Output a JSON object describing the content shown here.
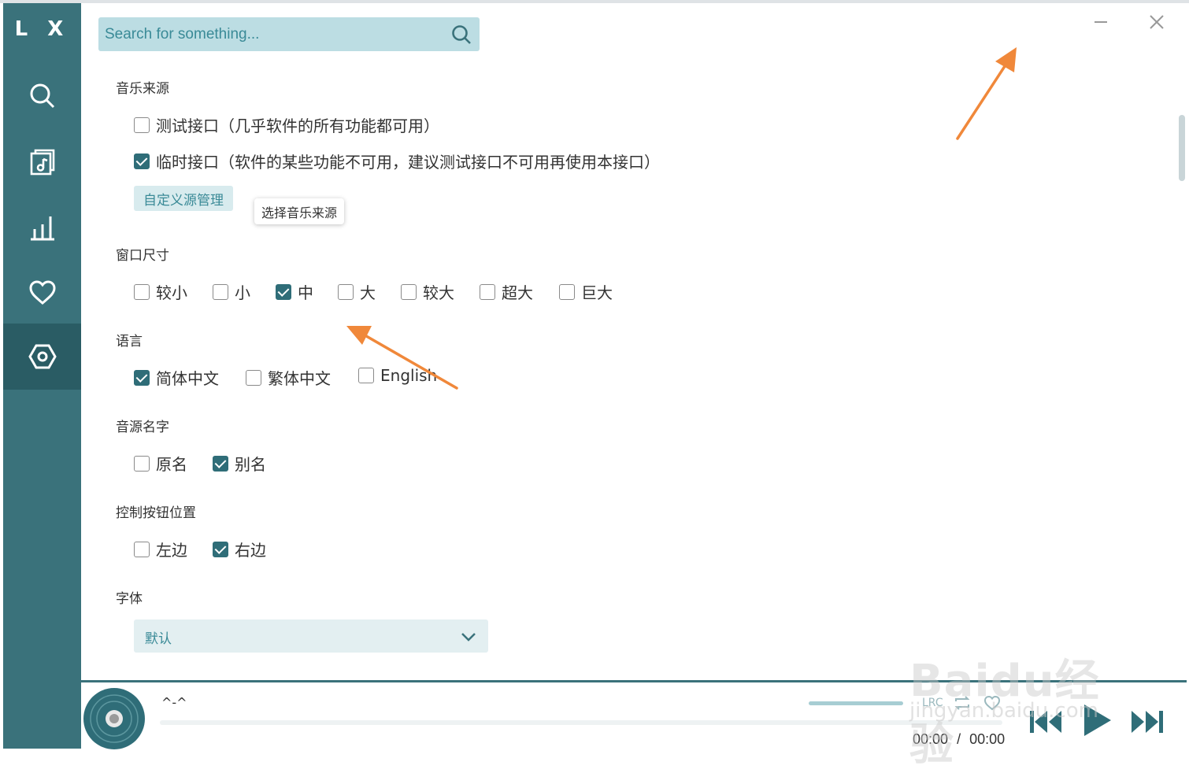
{
  "app": {
    "logo": "L X"
  },
  "sidebar": {
    "items": [
      {
        "name": "search"
      },
      {
        "name": "song-list"
      },
      {
        "name": "leaderboard"
      },
      {
        "name": "favorites"
      },
      {
        "name": "settings",
        "active": true
      }
    ]
  },
  "search": {
    "placeholder": "Search for something..."
  },
  "settings": {
    "music_source": {
      "title": "音乐来源",
      "options": [
        {
          "label": "测试接口（几乎软件的所有功能都可用）",
          "checked": false
        },
        {
          "label": "临时接口（软件的某些功能不可用，建议测试接口不可用再使用本接口）",
          "checked": true
        }
      ],
      "custom_button": "自定义源管理",
      "tooltip": "选择音乐来源"
    },
    "window_size": {
      "title": "窗口尺寸",
      "options": [
        {
          "label": "较小",
          "checked": false
        },
        {
          "label": "小",
          "checked": false
        },
        {
          "label": "中",
          "checked": true
        },
        {
          "label": "大",
          "checked": false
        },
        {
          "label": "较大",
          "checked": false
        },
        {
          "label": "超大",
          "checked": false
        },
        {
          "label": "巨大",
          "checked": false
        }
      ]
    },
    "language": {
      "title": "语言",
      "options": [
        {
          "label": "简体中文",
          "checked": true
        },
        {
          "label": "繁体中文",
          "checked": false
        },
        {
          "label": "English",
          "checked": false
        }
      ]
    },
    "source_name": {
      "title": "音源名字",
      "options": [
        {
          "label": "原名",
          "checked": false
        },
        {
          "label": "别名",
          "checked": true
        }
      ]
    },
    "control_position": {
      "title": "控制按钮位置",
      "options": [
        {
          "label": "左边",
          "checked": false
        },
        {
          "label": "右边",
          "checked": true
        }
      ]
    },
    "font": {
      "title": "字体",
      "selected": "默认"
    }
  },
  "player": {
    "song_name": "^-^",
    "lrc_label": "LRC",
    "current_time": "00:00",
    "separator": "/",
    "total_time": "00:00",
    "progress": 0
  },
  "watermark": {
    "brand": "Baidu经验",
    "url": "jingyan.baidu.com"
  },
  "colors": {
    "accent": "#3a727b",
    "checkbox": "#2f6d78",
    "annotation_arrow": "#f0883a"
  }
}
